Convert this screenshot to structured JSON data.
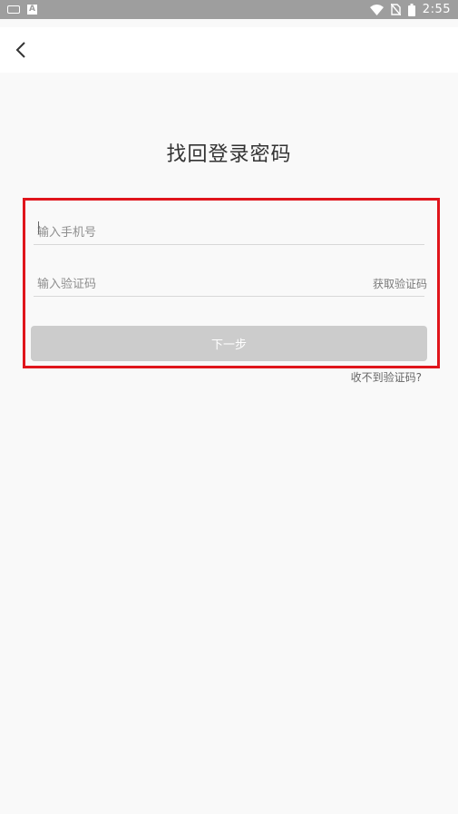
{
  "status_bar": {
    "time": "2:55",
    "icons": [
      "keyboard-icon",
      "a-icon",
      "wifi-icon",
      "no-sim-icon",
      "battery-icon"
    ]
  },
  "app_bar": {
    "back_icon": "chevron-left-icon"
  },
  "page": {
    "title": "找回登录密码"
  },
  "form": {
    "phone_placeholder": "输入手机号",
    "code_placeholder": "输入验证码",
    "get_code_label": "获取验证码",
    "next_label": "下一步",
    "no_code_label": "收不到验证码?"
  },
  "colors": {
    "highlight": "#e0151c",
    "button_disabled": "#cccccc",
    "status_bar": "#9e9e9e"
  }
}
